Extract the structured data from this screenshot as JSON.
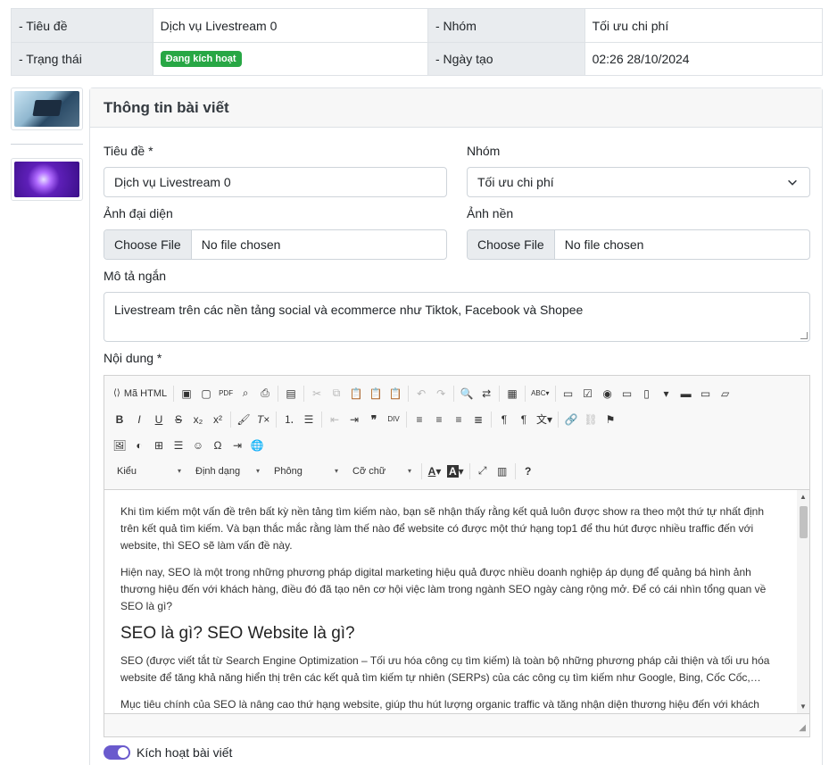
{
  "summary": {
    "rows": [
      {
        "label1": "- Tiêu đề",
        "value1": "Dịch vụ Livestream 0",
        "label2": "- Nhóm",
        "value2": "Tối ưu chi phí"
      },
      {
        "label1": "- Trạng thái",
        "badge": "Đang kích hoạt",
        "label2": "- Ngày tạo",
        "value2": "02:26 28/10/2024"
      }
    ],
    "badge_color": "#28a745"
  },
  "thumbnails": [
    {
      "name": "laptop-thumbnail"
    },
    {
      "name": "purple-graphic-thumbnail"
    }
  ],
  "card": {
    "title": "Thông tin bài viết",
    "title_label": "Tiêu đề *",
    "title_value": "Dịch vụ Livestream 0",
    "group_label": "Nhóm",
    "group_value": "Tối ưu chi phí",
    "avatar_label": "Ảnh đại diện",
    "background_label": "Ảnh nền",
    "choose_file": "Choose File",
    "no_file": "No file chosen",
    "short_desc_label": "Mô tả ngắn",
    "short_desc_value": "Livestream trên các nền tảng social và ecommerce như Tiktok, Facebook và Shopee",
    "content_label": "Nội dung *",
    "activate_label": "Kích hoạt bài viết"
  },
  "editor": {
    "source_label": "Mã HTML",
    "combos": {
      "style": "Kiểu",
      "format": "Định dạng",
      "font": "Phông",
      "size": "Cỡ chữ"
    },
    "paragraphs": [
      "Khi tìm kiếm một vấn đề trên bất kỳ nền tảng tìm kiếm nào, bạn sẽ nhận thấy rằng kết quả luôn được show ra theo một thứ tự nhất định trên kết quả tìm kiếm. Và bạn thắc mắc rằng làm thế nào để website có được một thứ hạng top1 để thu hút được nhiều traffic đến với website, thì SEO sẽ làm vấn đề này.",
      "Hiện nay, SEO là một trong những phương pháp digital marketing hiệu quả được nhiều doanh nghiệp áp dụng để quảng bá hình ảnh thương hiệu đến với khách hàng, điều đó đã tạo nên cơ hội việc làm trong ngành SEO ngày càng rộng mở. Để có cái nhìn tổng quan về SEO là gì?"
    ],
    "heading": "SEO là gì? SEO Website là gì?",
    "paragraphs2": [
      "SEO (được viết tắt từ Search Engine Optimization – Tối ưu hóa công cụ tìm kiếm) là toàn bộ những phương pháp cải thiện và tối ưu hóa website để tăng khả năng hiển thị trên các kết quả tìm kiếm tự nhiên (SERPs) của các công cụ tìm kiếm như Google, Bing, Cốc Cốc,…",
      "Mục tiêu chính của SEO là nâng cao thứ hạng website, giúp thu hút lượng organic traffic và tăng nhận diện thương hiệu đến với khách hàng, gia tăng doanh thu cho doanh nghiệp. Có thể thấy, thứ hạng càng cao thì càng thu hút được nhiều lượng truy cập."
    ]
  },
  "colors": {
    "toggle": "#6a5acd",
    "header_bg": "#f7f7f7"
  }
}
